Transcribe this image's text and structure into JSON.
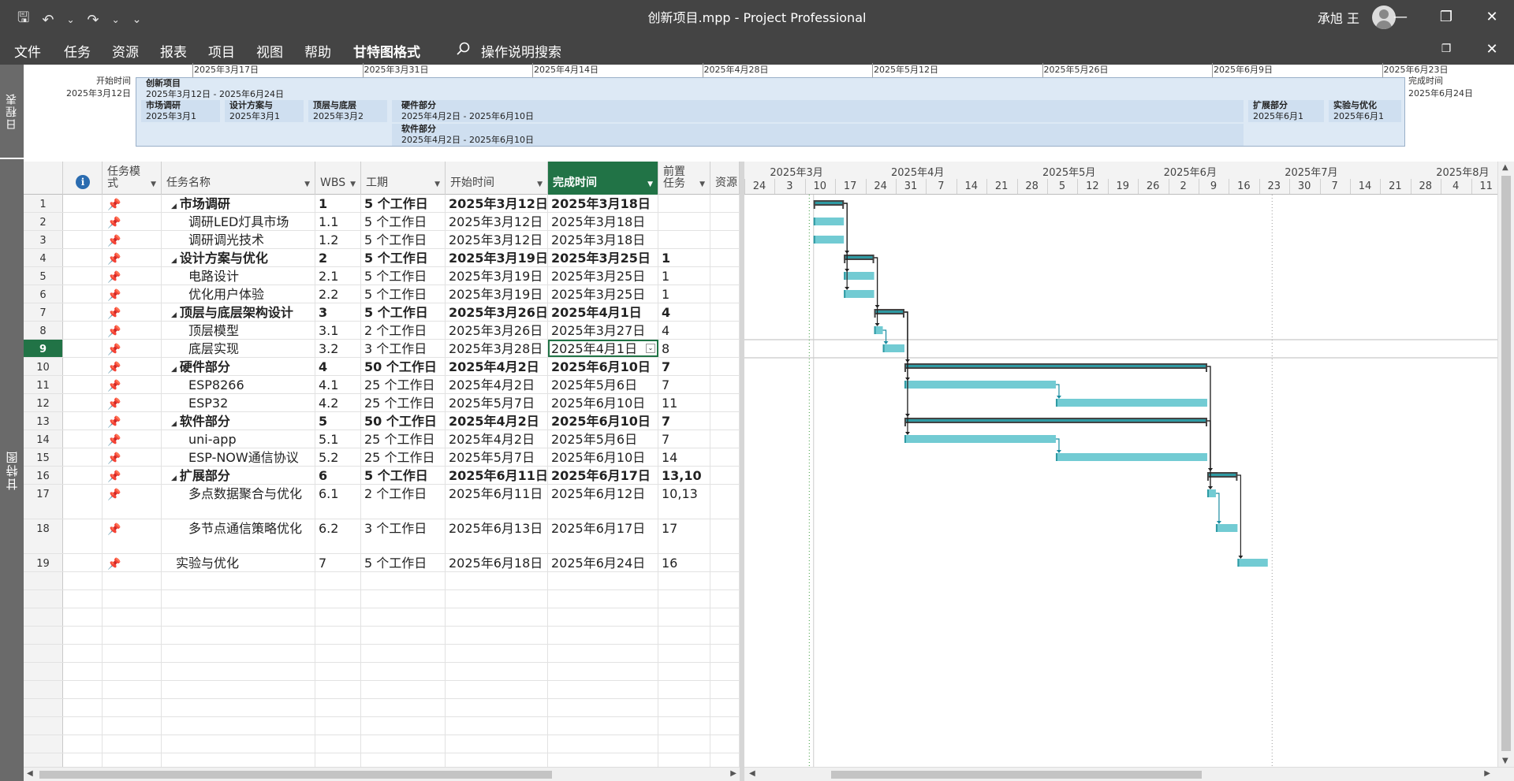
{
  "app": {
    "title": "创新项目.mpp  -  Project Professional",
    "user": "承旭 王",
    "qat": {
      "save": "🖫",
      "undo": "↶",
      "redo": "↷",
      "more": "⌄"
    },
    "window": {
      "minimize": "—",
      "restore": "❐",
      "close": "✕"
    }
  },
  "menu": {
    "tabs": [
      "文件",
      "任务",
      "资源",
      "报表",
      "项目",
      "视图",
      "帮助",
      "甘特图格式"
    ],
    "active_tab": "甘特图格式",
    "search": "操作说明搜索"
  },
  "timeline": {
    "side_label": "日程表",
    "start_label": "开始时间",
    "start_date": "2025年3月12日",
    "end_label": "完成时间",
    "end_date": "2025年6月24日",
    "ticks": [
      "2025年3月17日",
      "2025年3月31日",
      "2025年4月14日",
      "2025年4月28日",
      "2025年5月12日",
      "2025年5月26日",
      "2025年6月9日",
      "2025年6月23日"
    ],
    "project": {
      "name": "创新项目",
      "range": "2025年3月12日 - 2025年6月24日"
    },
    "items": [
      {
        "name": "市场调研",
        "date": "2025年3月1"
      },
      {
        "name": "设计方案与",
        "date": "2025年3月1"
      },
      {
        "name": "顶层与底层",
        "date": "2025年3月2"
      },
      {
        "name": "硬件部分",
        "date": "2025年4月2日 - 2025年6月10日"
      },
      {
        "name": "软件部分",
        "date": "2025年4月2日 - 2025年6月10日"
      },
      {
        "name": "扩展部分",
        "date": "2025年6月1"
      },
      {
        "name": "实验与优化",
        "date": "2025年6月1"
      }
    ]
  },
  "gantt_label": "甘特图",
  "table": {
    "headers": {
      "info": "i",
      "mode": "任务模式",
      "name": "任务名称",
      "wbs": "WBS",
      "duration": "工期",
      "start": "开始时间",
      "finish": "完成时间",
      "pred": "前置任务",
      "resource": "资源"
    },
    "rows": [
      {
        "id": "1",
        "name": "市场调研",
        "wbs": "1",
        "duration": "5 个工作日",
        "start": "2025年3月12日",
        "finish": "2025年3月18日",
        "pred": "",
        "summary": true
      },
      {
        "id": "2",
        "name": "调研LED灯具市场",
        "wbs": "1.1",
        "duration": "5 个工作日",
        "start": "2025年3月12日",
        "finish": "2025年3月18日",
        "pred": "",
        "summary": false
      },
      {
        "id": "3",
        "name": "调研调光技术",
        "wbs": "1.2",
        "duration": "5 个工作日",
        "start": "2025年3月12日",
        "finish": "2025年3月18日",
        "pred": "",
        "summary": false
      },
      {
        "id": "4",
        "name": "设计方案与优化",
        "wbs": "2",
        "duration": "5 个工作日",
        "start": "2025年3月19日",
        "finish": "2025年3月25日",
        "pred": "1",
        "summary": true
      },
      {
        "id": "5",
        "name": "电路设计",
        "wbs": "2.1",
        "duration": "5 个工作日",
        "start": "2025年3月19日",
        "finish": "2025年3月25日",
        "pred": "1",
        "summary": false
      },
      {
        "id": "6",
        "name": "优化用户体验",
        "wbs": "2.2",
        "duration": "5 个工作日",
        "start": "2025年3月19日",
        "finish": "2025年3月25日",
        "pred": "1",
        "summary": false
      },
      {
        "id": "7",
        "name": "顶层与底层架构设计",
        "wbs": "3",
        "duration": "5 个工作日",
        "start": "2025年3月26日",
        "finish": "2025年4月1日",
        "pred": "4",
        "summary": true
      },
      {
        "id": "8",
        "name": "顶层模型",
        "wbs": "3.1",
        "duration": "2 个工作日",
        "start": "2025年3月26日",
        "finish": "2025年3月27日",
        "pred": "4",
        "summary": false
      },
      {
        "id": "9",
        "name": "底层实现",
        "wbs": "3.2",
        "duration": "3 个工作日",
        "start": "2025年3月28日",
        "finish": "2025年4月1日",
        "pred": "8",
        "summary": false
      },
      {
        "id": "10",
        "name": "硬件部分",
        "wbs": "4",
        "duration": "50 个工作日",
        "start": "2025年4月2日",
        "finish": "2025年6月10日",
        "pred": "7",
        "summary": true
      },
      {
        "id": "11",
        "name": "ESP8266",
        "wbs": "4.1",
        "duration": "25 个工作日",
        "start": "2025年4月2日",
        "finish": "2025年5月6日",
        "pred": "7",
        "summary": false
      },
      {
        "id": "12",
        "name": "ESP32",
        "wbs": "4.2",
        "duration": "25 个工作日",
        "start": "2025年5月7日",
        "finish": "2025年6月10日",
        "pred": "11",
        "summary": false
      },
      {
        "id": "13",
        "name": "软件部分",
        "wbs": "5",
        "duration": "50 个工作日",
        "start": "2025年4月2日",
        "finish": "2025年6月10日",
        "pred": "7",
        "summary": true
      },
      {
        "id": "14",
        "name": "uni-app",
        "wbs": "5.1",
        "duration": "25 个工作日",
        "start": "2025年4月2日",
        "finish": "2025年5月6日",
        "pred": "7",
        "summary": false
      },
      {
        "id": "15",
        "name": "ESP-NOW通信协议",
        "wbs": "5.2",
        "duration": "25 个工作日",
        "start": "2025年5月7日",
        "finish": "2025年6月10日",
        "pred": "14",
        "summary": false
      },
      {
        "id": "16",
        "name": "扩展部分",
        "wbs": "6",
        "duration": "5 个工作日",
        "start": "2025年6月11日",
        "finish": "2025年6月17日",
        "pred": "13,10",
        "summary": true
      },
      {
        "id": "17",
        "name": "多点数据聚合与优化",
        "wbs": "6.1",
        "duration": "2 个工作日",
        "start": "2025年6月11日",
        "finish": "2025年6月12日",
        "pred": "10,13",
        "summary": false
      },
      {
        "id": "18",
        "name": "多节点通信策略优化",
        "wbs": "6.2",
        "duration": "3 个工作日",
        "start": "2025年6月13日",
        "finish": "2025年6月17日",
        "pred": "17",
        "summary": false
      },
      {
        "id": "19",
        "name": "实验与优化",
        "wbs": "7",
        "duration": "5 个工作日",
        "start": "2025年6月18日",
        "finish": "2025年6月24日",
        "pred": "16",
        "summary": false
      }
    ],
    "current_row": "9"
  },
  "gantt": {
    "months": [
      "2025年3月",
      "2025年4月",
      "2025年5月",
      "2025年6月",
      "2025年7月",
      "2025年8月"
    ],
    "days": [
      "24",
      "3",
      "10",
      "17",
      "24",
      "31",
      "7",
      "14",
      "21",
      "28",
      "5",
      "12",
      "19",
      "26",
      "2",
      "9",
      "16",
      "23",
      "30",
      "7",
      "14",
      "21",
      "28",
      "4",
      "11"
    ],
    "colors": {
      "bar": "#72cbd3",
      "bar_dark": "#2e9aa3",
      "summary": "#444444",
      "link": "#1a8ca0"
    }
  }
}
